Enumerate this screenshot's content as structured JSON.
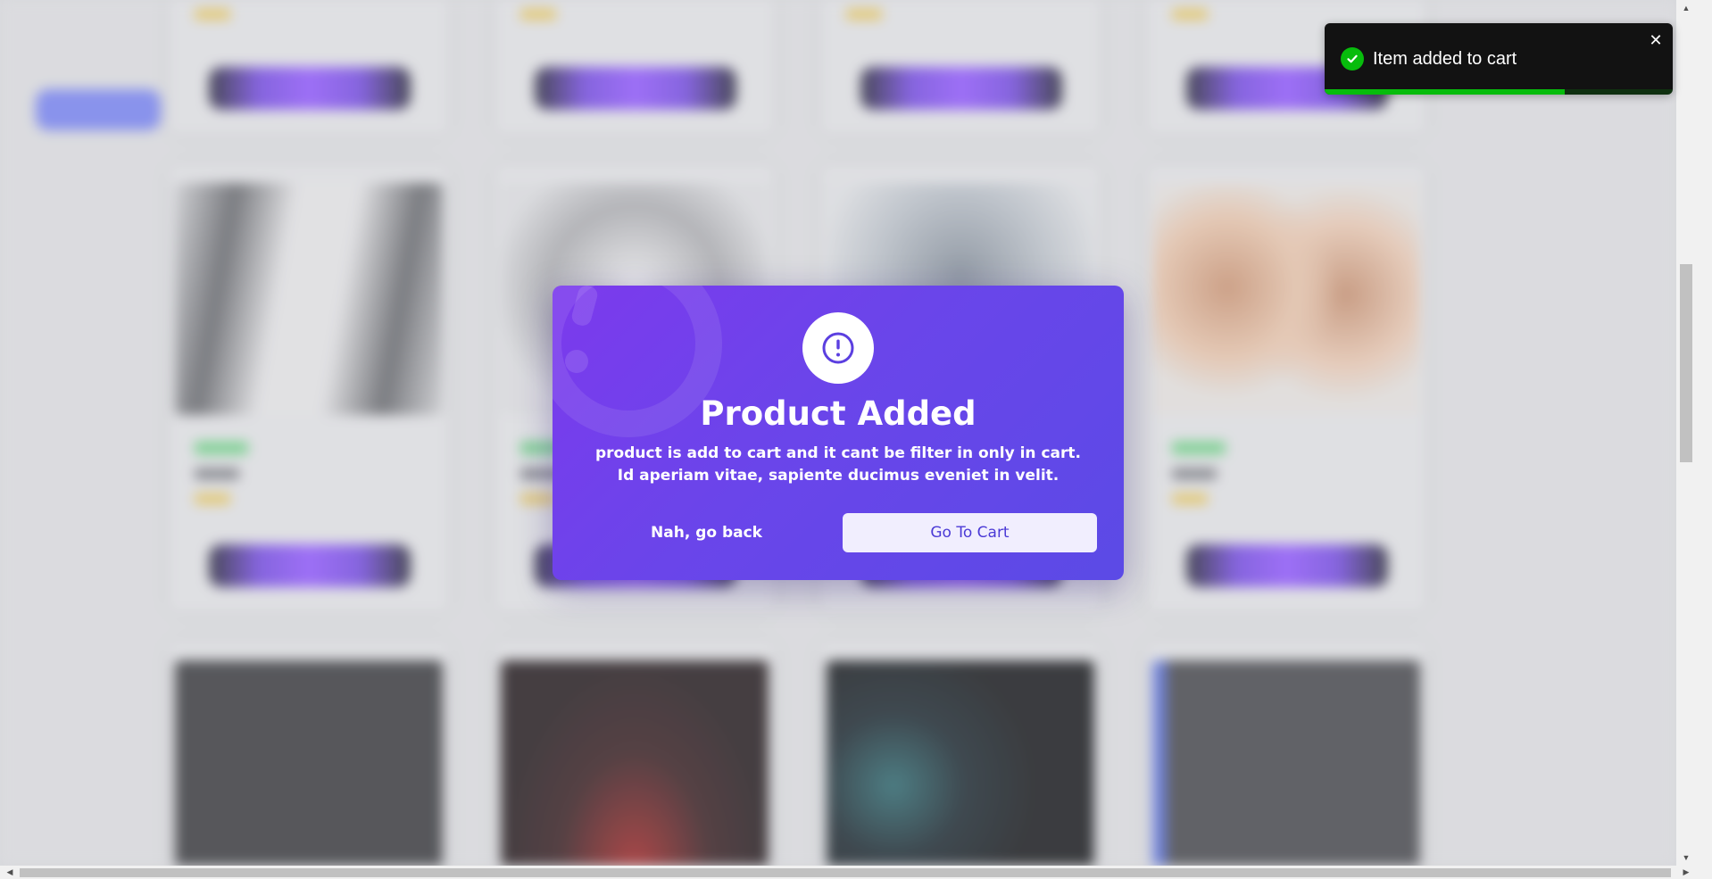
{
  "modal": {
    "icon": "exclamation-circle-icon",
    "title": "Product Added",
    "message": "product is add to cart and it cant be filter in only in cart. Id aperiam vitae, sapiente ducimus eveniet in velit.",
    "cancel_label": "Nah, go back",
    "confirm_label": "Go To Cart",
    "colors": {
      "gradient_start": "#7c3aed",
      "gradient_end": "#5b4ae6",
      "confirm_bg": "#f1eefe",
      "confirm_text": "#4b3ad6"
    }
  },
  "toast": {
    "icon": "check-circle-icon",
    "message": "Item added to cart",
    "close_icon": "close-icon",
    "progress": 0.69,
    "colors": {
      "background": "#121212",
      "accent": "#07bc0c"
    }
  }
}
